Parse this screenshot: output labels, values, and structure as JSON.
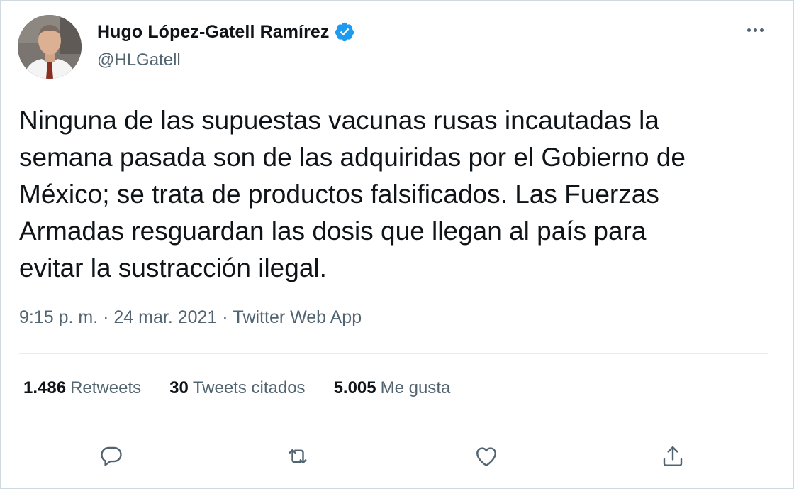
{
  "author": {
    "name": "Hugo López-Gatell Ramírez",
    "handle": "@HLGatell",
    "verified": true
  },
  "tweet": {
    "lines": [
      "Ninguna de las supuestas vacunas rusas incautadas la",
      "semana pasada son de las adquiridas por el Gobierno de",
      "México; se trata de productos falsificados. Las Fuerzas",
      "Armadas resguardan las dosis que llegan al país para",
      "evitar la sustracción ilegal."
    ],
    "time": "9:15 p. m.",
    "separator": " · ",
    "date": "24 mar. 2021",
    "source": "Twitter Web App"
  },
  "stats": {
    "retweets_count": "1.486",
    "retweets_label": "Retweets",
    "quotes_count": "30",
    "quotes_label": "Tweets citados",
    "likes_count": "5.005",
    "likes_label": "Me gusta"
  },
  "icons": {
    "more": "more-horizontal-icon",
    "reply": "reply-icon",
    "retweet": "retweet-icon",
    "like": "heart-icon",
    "share": "share-icon",
    "verified": "verified-badge-icon"
  },
  "colors": {
    "text_primary": "#0f1419",
    "text_secondary": "#536471",
    "verified_blue": "#1d9bf0",
    "divider": "#e6ecf0"
  }
}
